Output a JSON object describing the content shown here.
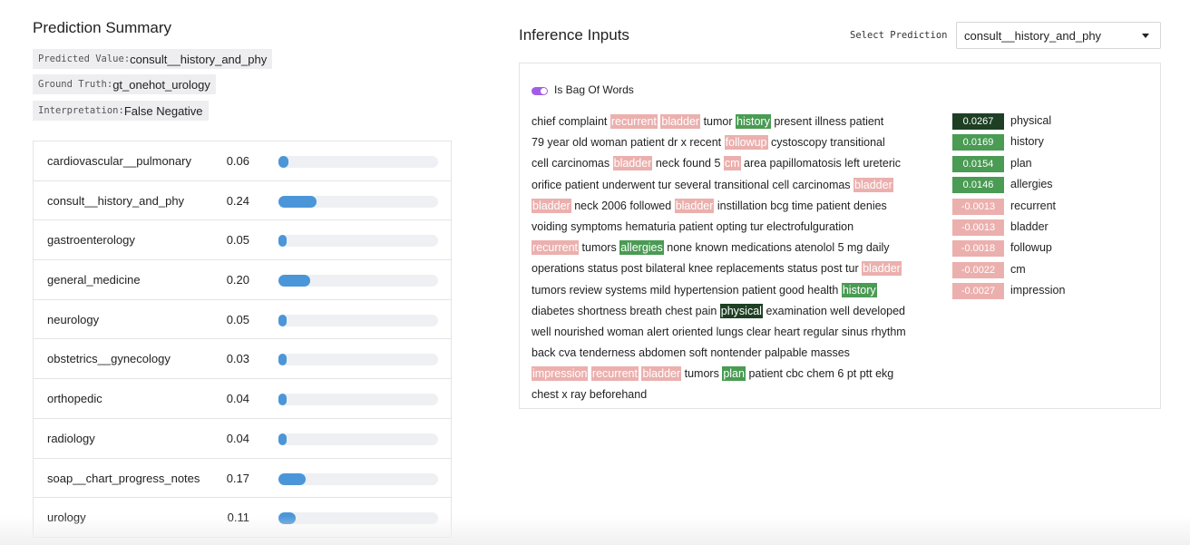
{
  "summary": {
    "title": "Prediction Summary",
    "predicted_key": "Predicted Value:",
    "predicted_value": "consult__history_and_phy",
    "ground_truth_key": "Ground Truth:",
    "ground_truth_value": "gt_onehot_urology",
    "interpretation_key": "Interpretation:",
    "interpretation_value": "False Negative"
  },
  "probabilities": [
    {
      "label": "cardiovascular__pulmonary",
      "value_text": "0.06",
      "value": 0.06
    },
    {
      "label": "consult__history_and_phy",
      "value_text": "0.24",
      "value": 0.24
    },
    {
      "label": "gastroenterology",
      "value_text": "0.05",
      "value": 0.05
    },
    {
      "label": "general_medicine",
      "value_text": "0.20",
      "value": 0.2
    },
    {
      "label": "neurology",
      "value_text": "0.05",
      "value": 0.05
    },
    {
      "label": "obstetrics__gynecology",
      "value_text": "0.03",
      "value": 0.03
    },
    {
      "label": "orthopedic",
      "value_text": "0.04",
      "value": 0.04
    },
    {
      "label": "radiology",
      "value_text": "0.04",
      "value": 0.04
    },
    {
      "label": "soap__chart_progress_notes",
      "value_text": "0.17",
      "value": 0.17
    },
    {
      "label": "urology",
      "value_text": "0.11",
      "value": 0.11
    }
  ],
  "inference": {
    "title": "Inference Inputs",
    "select_label": "Select Prediction",
    "select_value": "consult__history_and_phy",
    "toggle_label": "Is Bag Of Words",
    "toggle_on": true
  },
  "text_lines": [
    [
      [
        "chief complaint",
        ""
      ],
      [
        "recurrent",
        "neg"
      ],
      [
        "bladder",
        "neg"
      ],
      [
        "tumor",
        ""
      ],
      [
        "history",
        "pos"
      ],
      [
        "present illness patient",
        ""
      ]
    ],
    [
      [
        "79 year old woman patient dr x recent",
        ""
      ],
      [
        "followup",
        "neg"
      ],
      [
        "cystoscopy transitional",
        ""
      ]
    ],
    [
      [
        "cell carcinomas",
        ""
      ],
      [
        "bladder",
        "neg"
      ],
      [
        "neck found 5",
        ""
      ],
      [
        "cm",
        "neg"
      ],
      [
        "area papillomatosis left ureteric",
        ""
      ]
    ],
    [
      [
        "orifice patient underwent tur several transitional cell carcinomas",
        ""
      ],
      [
        "bladder",
        "neg"
      ]
    ],
    [
      [
        "bladder",
        "neg"
      ],
      [
        "neck 2006 followed",
        ""
      ],
      [
        "bladder",
        "neg"
      ],
      [
        "instillation bcg time patient denies",
        ""
      ]
    ],
    [
      [
        "voiding symptoms hematuria patient opting tur electrofulguration",
        ""
      ]
    ],
    [
      [
        "recurrent",
        "neg"
      ],
      [
        "tumors",
        ""
      ],
      [
        "allergies",
        "pos"
      ],
      [
        "none known medications atenolol 5 mg daily",
        ""
      ]
    ],
    [
      [
        "operations status post bilateral knee replacements status post tur",
        ""
      ],
      [
        "bladder",
        "neg"
      ]
    ],
    [
      [
        "tumors review systems mild hypertension patient good health",
        ""
      ],
      [
        "history",
        "pos"
      ]
    ],
    [
      [
        "diabetes shortness breath chest pain",
        ""
      ],
      [
        "physical",
        "strong"
      ],
      [
        "examination well developed",
        ""
      ]
    ],
    [
      [
        "well nourished woman alert oriented lungs clear heart regular sinus rhythm",
        ""
      ]
    ],
    [
      [
        "back cva tenderness abdomen soft nontender palpable masses",
        ""
      ]
    ],
    [
      [
        "impression",
        "neg"
      ],
      [
        "recurrent",
        "neg"
      ],
      [
        "bladder",
        "neg"
      ],
      [
        "tumors",
        ""
      ],
      [
        "plan",
        "pos"
      ],
      [
        "patient cbc chem 6 pt ptt ekg",
        ""
      ]
    ],
    [
      [
        "chest x ray beforehand",
        ""
      ]
    ]
  ],
  "attributions": [
    {
      "score": "0.0267",
      "word": "physical",
      "color": "#1e3f23"
    },
    {
      "score": "0.0169",
      "word": "history",
      "color": "#4a9b53"
    },
    {
      "score": "0.0154",
      "word": "plan",
      "color": "#4a9b53"
    },
    {
      "score": "0.0146",
      "word": "allergies",
      "color": "#4a9b53"
    },
    {
      "score": "-0.0013",
      "word": "recurrent",
      "color": "#ebb0ae"
    },
    {
      "score": "-0.0013",
      "word": "bladder",
      "color": "#ebb0ae"
    },
    {
      "score": "-0.0018",
      "word": "followup",
      "color": "#ebb0ae"
    },
    {
      "score": "-0.0022",
      "word": "cm",
      "color": "#ebb0ae"
    },
    {
      "score": "-0.0027",
      "word": "impression",
      "color": "#ebb0ae"
    }
  ],
  "colors": {
    "bar_fill": "#4b96d8",
    "bar_track": "#eef0f3",
    "positive": "#4a9b53",
    "strong_positive": "#1e3f23",
    "negative": "#ebb0ae",
    "toggle": "#a05ee8"
  }
}
